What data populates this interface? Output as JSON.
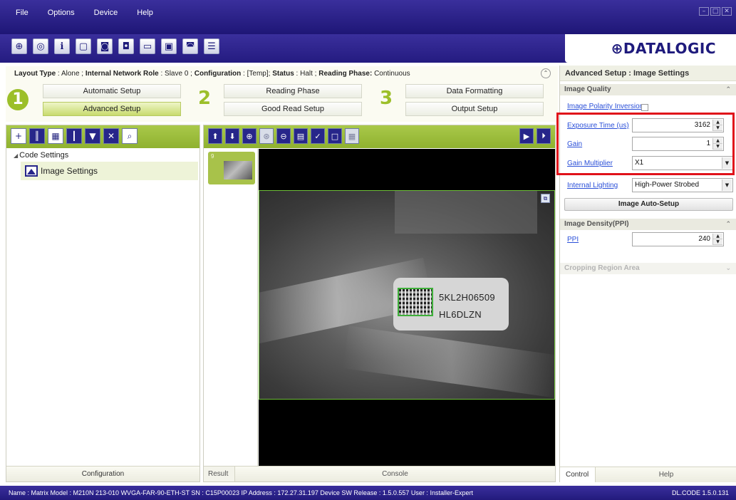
{
  "menu": [
    "File",
    "Options",
    "Device",
    "Help"
  ],
  "window_controls": [
    "–",
    "□",
    "✕"
  ],
  "brand": {
    "name": "⊕DATALOGIC"
  },
  "toolbar_icons": [
    "target-icon",
    "wand-icon",
    "info-icon",
    "window-icon",
    "camera-icon",
    "camera-settings-icon",
    "folder-icon",
    "save-icon",
    "camera-send-icon",
    "config-list-icon"
  ],
  "status": {
    "layout_type_label": "Layout Type",
    "layout_type": "Alone",
    "network_role_label": "Internal Network Role",
    "network_role": "Slave 0",
    "configuration_label": "Configuration",
    "configuration": "[Temp]",
    "status_label": "Status",
    "status": "Halt",
    "phase_label": "Reading Phase:",
    "phase": "Continuous"
  },
  "setup": {
    "step1": "1",
    "step2": "2",
    "step3": "3",
    "automatic": "Automatic Setup",
    "advanced": "Advanced Setup",
    "reading_phase": "Reading Phase",
    "good_read": "Good Read Setup",
    "data_formatting": "Data Formatting",
    "output_setup": "Output Setup"
  },
  "left_panel": {
    "tree_root": "Code Settings",
    "tree_child": "Image Settings",
    "footer": "Configuration"
  },
  "center_panel": {
    "thumb_number": "9",
    "label_line1": "5KL2H06509",
    "label_line2": "HL6DLZN",
    "tab_result": "Result",
    "tab_console": "Console"
  },
  "right_panel": {
    "title": "Advanced Setup : Image Settings",
    "image_quality": "Image Quality",
    "polarity": "Image Polarity Inversion",
    "exposure_label": "Exposure Time (us)",
    "exposure_value": "3162",
    "gain_label": "Gain",
    "gain_value": "1",
    "gain_mult_label": "Gain Multiplier",
    "gain_mult_value": "X1",
    "lighting_label": "Internal Lighting",
    "lighting_value": "High-Power Strobed",
    "auto_setup": "Image Auto-Setup",
    "density_head": "Image Density(PPI)",
    "ppi_label": "PPI",
    "ppi_value": "240",
    "cropping_head": "Cropping Region Area",
    "tab_control": "Control",
    "tab_help": "Help"
  },
  "statusbar": {
    "left": "Name : Matrix  Model : M210N 213-010 WVGA-FAR-90-ETH-ST  SN : C15P00023  IP Address :  172.27.31.197  Device SW Release : 1.5.0.557  User : Installer-Expert",
    "right": "DL.CODE 1.5.0.131"
  },
  "colors": {
    "accent_green": "#9cbf2a",
    "brand_blue": "#27268a",
    "highlight_red": "#e0111a",
    "link_blue": "#2a4fd8"
  }
}
